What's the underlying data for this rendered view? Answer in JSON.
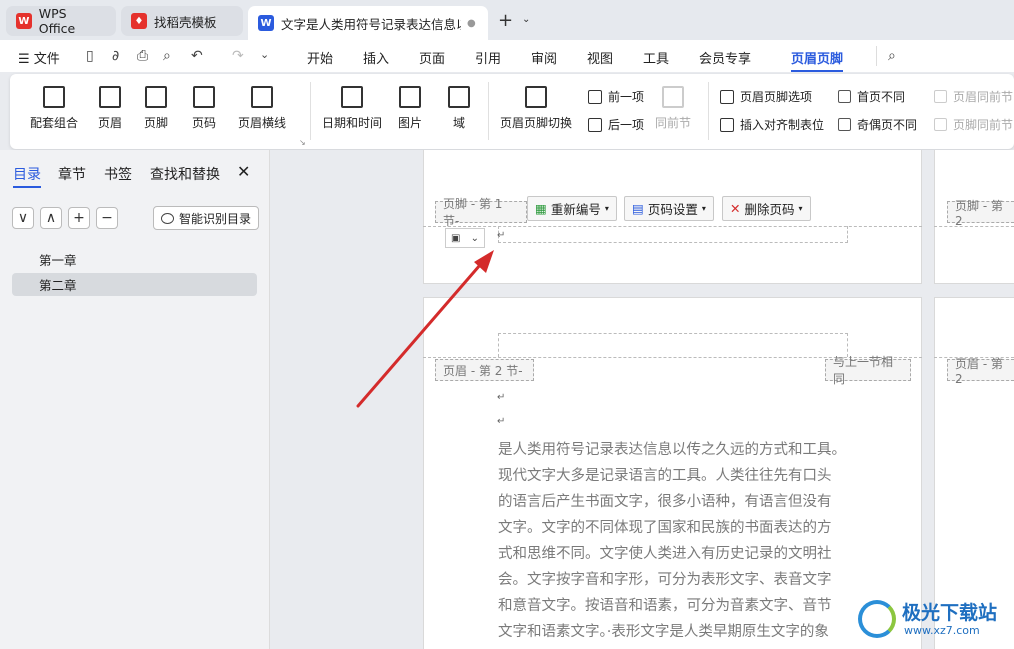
{
  "tabs": [
    {
      "label": "WPS Office",
      "icon": "wps-logo-icon",
      "color": "#e5322d"
    },
    {
      "label": "找稻壳模板",
      "icon": "docer-logo-icon",
      "color": "#e5322d"
    },
    {
      "label": "文字是人类用符号记录表达信息以(",
      "icon": "word-doc-icon",
      "color": "#2b5bde"
    }
  ],
  "menu": {
    "file": "文件",
    "items": [
      "开始",
      "插入",
      "页面",
      "引用",
      "审阅",
      "视图",
      "工具",
      "会员专享",
      "页眉页脚"
    ],
    "active": "页眉页脚"
  },
  "ribbon": {
    "big": [
      "配套组合",
      "页眉",
      "页脚",
      "页码",
      "页眉横线",
      "日期和时间",
      "图片",
      "域",
      "页眉页脚切换"
    ],
    "nav": [
      "前一项",
      "后一项",
      "同前节"
    ],
    "options": [
      "页眉页脚选项",
      "插入对齐制表位"
    ],
    "checks": [
      "首页不同",
      "奇偶页不同",
      "页眉同前节",
      "页脚同前节"
    ]
  },
  "sidebar": {
    "tabs": [
      "目录",
      "章节",
      "书签",
      "查找和替换"
    ],
    "buttons": [
      "∨",
      "∧",
      "+",
      "−"
    ],
    "smart": "智能识别目录",
    "items": [
      "第一章",
      "第二章"
    ],
    "selected": "第二章"
  },
  "doc": {
    "footer_label": "页脚 - 第 1 节-",
    "footer_label_right": "页脚 - 第 2",
    "header_label": "页眉 - 第 2 节-",
    "header_label_right": "页眉 - 第 2",
    "same_as_prev": "与上一节相同",
    "renumber": "重新编号",
    "page_setting": "页码设置",
    "delete_page_no": "删除页码",
    "paragraph": [
      "是人类用符号记录表达信息以传之久远的方式和工具。",
      "现代文字大多是记录语言的工具。人类往往先有口头",
      "的语言后产生书面文字，很多小语种，有语言但没有",
      "文字。文字的不同体现了国家和民族的书面表达的方",
      "式和思维不同。文字使人类进入有历史记录的文明社",
      "会。文字按字音和字形，可分为表形文字、表音文字",
      "和意音文字。按语音和语素，可分为音素文字、音节",
      "文字和语素文字。·表形文字是人类早期原生文字的象"
    ]
  },
  "watermark": {
    "title": "极光下载站",
    "url": "www.xz7.com"
  },
  "colors": {
    "accent": "#2b5bde",
    "arrow": "#d42b2b"
  }
}
